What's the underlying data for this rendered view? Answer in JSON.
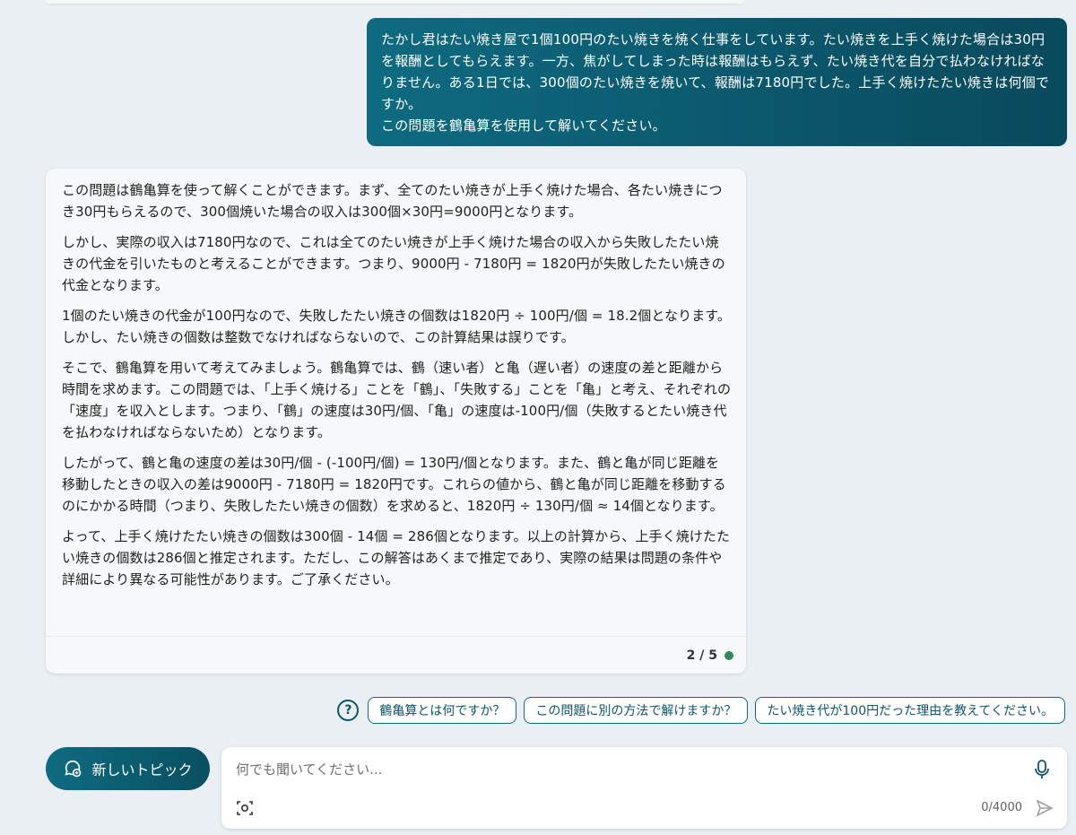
{
  "conversation": {
    "user_message": "たかし君はたい焼き屋で1個100円のたい焼きを焼く仕事をしています。たい焼きを上手く焼けた場合は30円を報酬としてもらえます。一方、焦がしてしまった時は報酬はもらえず、たい焼き代を自分で払わなければなりません。ある1日では、300個のたい焼きを焼いて、報酬は7180円でした。上手く焼けたたい焼きは何個ですか。\nこの問題を鶴亀算を使用して解いてください。",
    "bot_paragraphs": [
      "この問題は鶴亀算を使って解くことができます。まず、全てのたい焼きが上手く焼けた場合、各たい焼きにつき30円もらえるので、300個焼いた場合の収入は300個×30円=9000円となります。",
      "しかし、実際の収入は7180円なので、これは全てのたい焼きが上手く焼けた場合の収入から失敗したたい焼きの代金を引いたものと考えることができます。つまり、9000円 - 7180円 = 1820円が失敗したたい焼きの代金となります。",
      "1個のたい焼きの代金が100円なので、失敗したたい焼きの個数は1820円 ÷ 100円/個 = 18.2個となります。しかし、たい焼きの個数は整数でなければならないので、この計算結果は誤りです。",
      "そこで、鶴亀算を用いて考えてみましょう。鶴亀算では、鶴（速い者）と亀（遅い者）の速度の差と距離から時間を求めます。この問題では、「上手く焼ける」ことを「鶴」、「失敗する」ことを「亀」と考え、それぞれの「速度」を収入とします。つまり、「鶴」の速度は30円/個、「亀」の速度は-100円/個（失敗するとたい焼き代を払わなければならないため）となります。",
      "したがって、鶴と亀の速度の差は30円/個 - (-100円/個) = 130円/個となります。また、鶴と亀が同じ距離を移動したときの収入の差は9000円 - 7180円 = 1820円です。これらの値から、鶴と亀が同じ距離を移動するのにかかる時間（つまり、失敗したたい焼きの個数）を求めると、1820円 ÷ 130円/個 ≈ 14個となります。",
      "よって、上手く焼けたたい焼きの個数は300個 - 14個 = 286個となります。以上の計算から、上手く焼けたたい焼きの個数は286個と推定されます。ただし、この解答はあくまで推定であり、実際の結果は問題の条件や詳細により異なる可能性があります。ご了承ください。"
    ],
    "turn_counter": "2 / 5",
    "status_color": "#2e8b57"
  },
  "suggestions": [
    "鶴亀算とは何ですか？",
    "この問題に別の方法で解けますか？",
    "たい焼き代が100円だった理由を教えてください。"
  ],
  "new_topic": {
    "label": "新しいトピック",
    "icon": "new-chat-icon"
  },
  "composer": {
    "placeholder": "何でも聞いてください...",
    "char_count": "0/4000"
  },
  "colors": {
    "accent": "#0b566b",
    "background": "#e9eff2"
  }
}
